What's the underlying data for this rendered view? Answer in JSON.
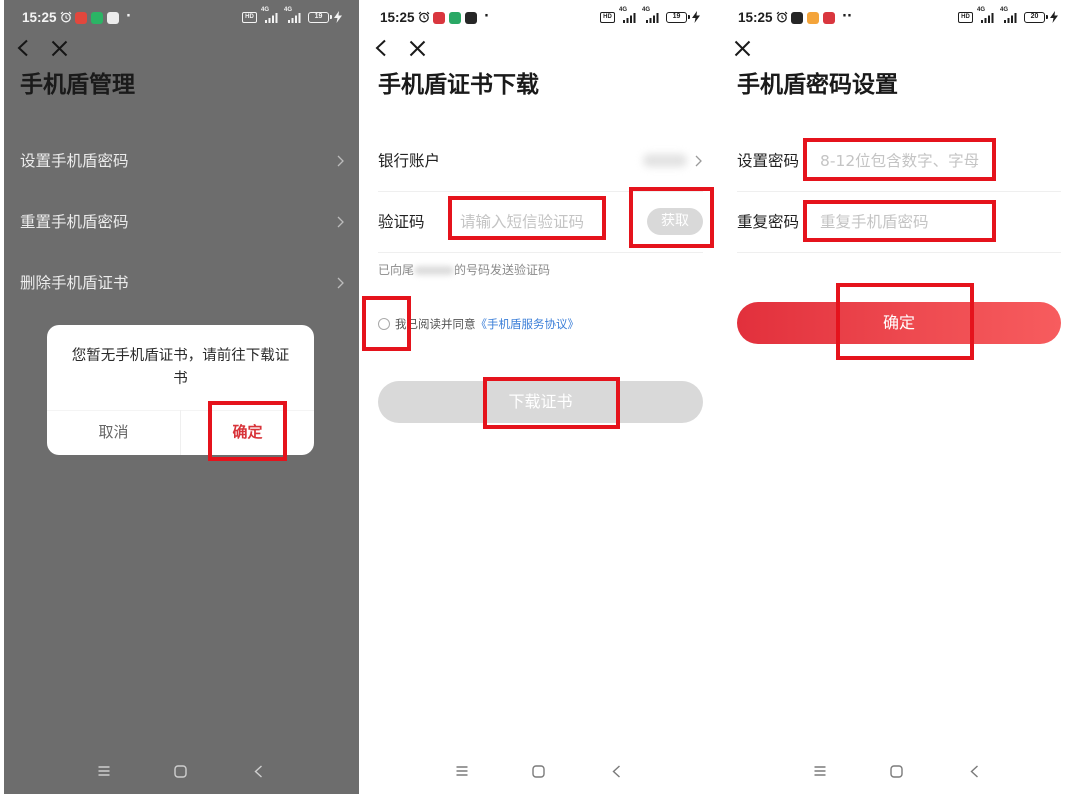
{
  "colors": {
    "accent_red": "#ee4a50",
    "confirm_text_red": "#d8343a",
    "highlight_red": "#e5131c",
    "link_blue": "#3c7fd8",
    "dim_overlay_grey": "#6d6d6d",
    "disabled_button_grey": "#d9d9d9"
  },
  "screen_manage": {
    "status": {
      "time": "15:25",
      "dots": "·",
      "hd": "HD",
      "network": "4G",
      "battery": "19",
      "app_icon_colors": [
        "#e2473d",
        "#2bb465",
        "#ececec"
      ]
    },
    "top_icons": [
      "chevron-left-icon",
      "close-icon"
    ],
    "title": "手机盾管理",
    "menu": [
      {
        "label": "设置手机盾密码",
        "icon": "chevron-right-icon"
      },
      {
        "label": "重置手机盾密码",
        "icon": "chevron-right-icon"
      },
      {
        "label": "删除手机盾证书",
        "icon": "chevron-right-icon"
      }
    ],
    "dialog": {
      "message": "您暂无手机盾证书，请前往下载证书",
      "cancel": "取消",
      "confirm": "确定"
    },
    "system_nav": [
      "menu-icon",
      "home-icon",
      "back-icon"
    ]
  },
  "screen_download": {
    "status": {
      "time": "15:25",
      "dots": "·",
      "hd": "HD",
      "network": "4G",
      "battery": "19",
      "app_icon_colors": [
        "#d9363e",
        "#2aa865",
        "#262626"
      ]
    },
    "top_icons": [
      "chevron-left-icon",
      "close-icon"
    ],
    "title": "手机盾证书下载",
    "bank_account": {
      "label": "银行账户",
      "icon": "chevron-right-icon"
    },
    "verify_code": {
      "label": "验证码",
      "placeholder": "请输入短信验证码",
      "get_button": "获取"
    },
    "sent_notice": {
      "prefix": "已向尾",
      "suffix": "的号码发送验证码"
    },
    "agreement": {
      "text": "我已阅读并同意",
      "link": "《手机盾服务协议》",
      "checked": false
    },
    "download_button": {
      "label": "下载证书",
      "enabled": false
    },
    "system_nav": [
      "menu-icon",
      "home-icon",
      "back-icon"
    ]
  },
  "screen_password": {
    "status": {
      "time": "15:25",
      "dots": "··",
      "hd": "HD",
      "network": "4G",
      "battery": "20",
      "app_icon_colors": [
        "#262626",
        "#f4a43a",
        "#d9363e"
      ]
    },
    "top_icons": [
      "close-icon"
    ],
    "title": "手机盾密码设置",
    "password": {
      "label": "设置密码",
      "placeholder": "8-12位包含数字、字母"
    },
    "repeat_password": {
      "label": "重复密码",
      "placeholder": "重复手机盾密码"
    },
    "confirm_button": {
      "label": "确定"
    },
    "system_nav": [
      "menu-icon",
      "home-icon",
      "back-icon"
    ]
  }
}
